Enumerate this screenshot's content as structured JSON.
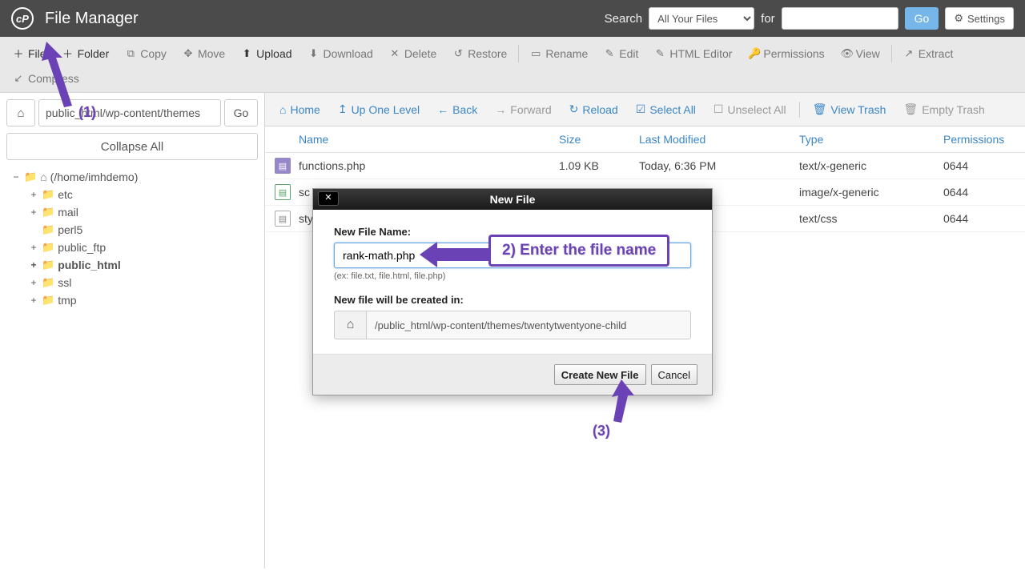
{
  "topbar": {
    "title": "File Manager",
    "search_label": "Search",
    "search_select": "All Your Files",
    "for_label": "for",
    "search_value": "",
    "go": "Go",
    "settings": "Settings"
  },
  "toolbar": {
    "file": "File",
    "folder": "Folder",
    "copy": "Copy",
    "move": "Move",
    "upload": "Upload",
    "download": "Download",
    "delete": "Delete",
    "restore": "Restore",
    "rename": "Rename",
    "edit": "Edit",
    "html_editor": "HTML Editor",
    "permissions": "Permissions",
    "view": "View",
    "extract": "Extract",
    "compress": "Compress"
  },
  "sidebar": {
    "path_value": "public_html/wp-content/themes",
    "go": "Go",
    "collapse_all": "Collapse All",
    "root_label": "(/home/imhdemo)",
    "items": [
      {
        "label": "etc",
        "bold": false
      },
      {
        "label": "mail",
        "bold": false
      },
      {
        "label": "perl5",
        "bold": false,
        "no_toggle": true
      },
      {
        "label": "public_ftp",
        "bold": false
      },
      {
        "label": "public_html",
        "bold": true
      },
      {
        "label": "ssl",
        "bold": false
      },
      {
        "label": "tmp",
        "bold": false
      }
    ]
  },
  "navbar": {
    "home": "Home",
    "up": "Up One Level",
    "back": "Back",
    "forward": "Forward",
    "reload": "Reload",
    "select_all": "Select All",
    "unselect_all": "Unselect All",
    "view_trash": "View Trash",
    "empty_trash": "Empty Trash"
  },
  "table": {
    "headers": {
      "name": "Name",
      "size": "Size",
      "modified": "Last Modified",
      "type": "Type",
      "permissions": "Permissions"
    },
    "rows": [
      {
        "name": "functions.php",
        "size": "1.09 KB",
        "modified": "Today, 6:36 PM",
        "type": "text/x-generic",
        "permissions": "0644",
        "icon": "php"
      },
      {
        "name": "sc",
        "size": "",
        "modified": "",
        "type": "image/x-generic",
        "permissions": "0644",
        "icon": "img"
      },
      {
        "name": "sty",
        "size": "",
        "modified": "",
        "type": "text/css",
        "permissions": "0644",
        "icon": "css"
      }
    ]
  },
  "modal": {
    "title": "New File",
    "name_label": "New File Name:",
    "name_value": "rank-math.php",
    "hint": "(ex: file.txt, file.html, file.php)",
    "path_label": "New file will be created in:",
    "path_value": "/public_html/wp-content/themes/twentytwentyone-child",
    "create": "Create New File",
    "cancel": "Cancel"
  },
  "annotations": {
    "step1": "(1)",
    "step2": "2) Enter the file name",
    "step3": "(3)"
  }
}
